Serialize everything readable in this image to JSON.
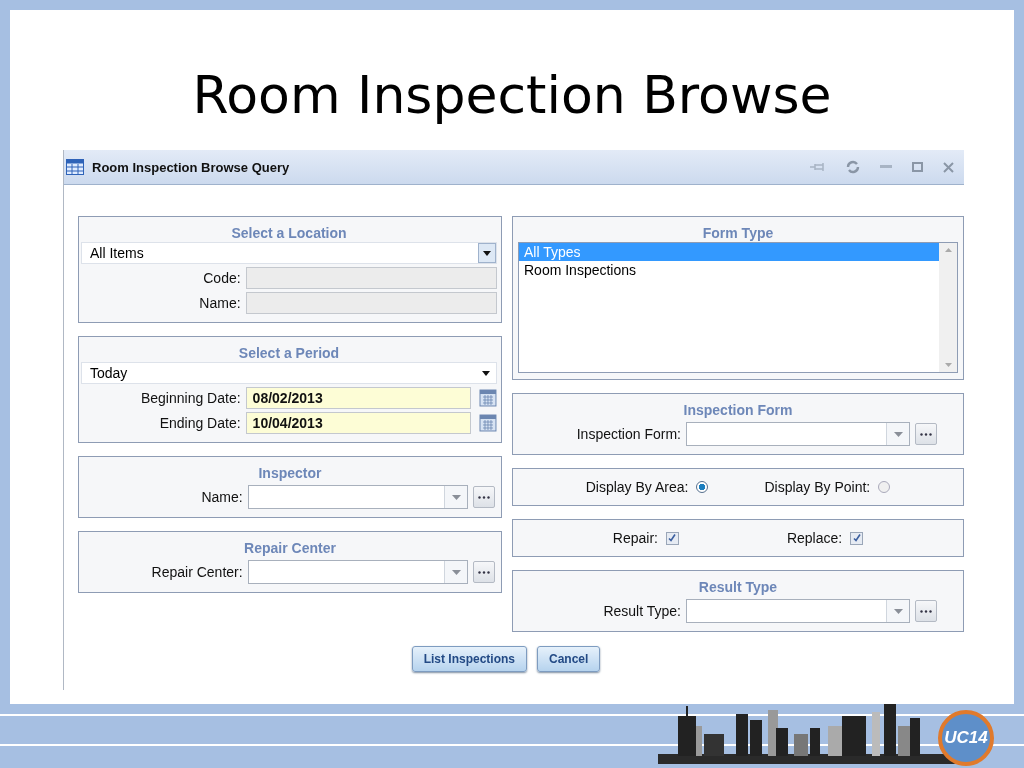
{
  "slide_title": "Room Inspection Browse",
  "window": {
    "title": "Room Inspection Browse Query"
  },
  "left_sections": [
    {
      "kind": "location",
      "heading": "Select a Location",
      "value": "All Items",
      "fields": [
        {
          "label": "Code:",
          "disabled": true
        },
        {
          "label": "Name:",
          "disabled": true
        }
      ]
    },
    {
      "kind": "period",
      "heading": "Select a Period",
      "value": "Today",
      "dates": [
        {
          "label": "Beginning Date:",
          "value": "08/02/2013"
        },
        {
          "label": "Ending Date:",
          "value": "10/04/2013"
        }
      ]
    },
    {
      "kind": "lookup",
      "heading": "Inspector",
      "label": "Name:"
    },
    {
      "kind": "lookup",
      "heading": "Repair Center",
      "label": "Repair Center:"
    }
  ],
  "right_sections": [
    {
      "kind": "listbox",
      "heading": "Form Type",
      "items": [
        {
          "label": "All Types",
          "selected": true
        },
        {
          "label": "Room Inspections",
          "selected": false
        }
      ]
    },
    {
      "kind": "lookup",
      "heading": "Inspection Form",
      "label": "Inspection Form:"
    },
    {
      "kind": "radios",
      "options": [
        {
          "label": "Display By Area:",
          "selected": true
        },
        {
          "label": "Display By Point:",
          "selected": false
        }
      ]
    },
    {
      "kind": "checks",
      "options": [
        {
          "label": "Repair:",
          "checked": true
        },
        {
          "label": "Replace:",
          "checked": true
        }
      ]
    },
    {
      "kind": "lookup",
      "heading": "Result Type",
      "label": "Result Type:"
    }
  ],
  "buttons": [
    "List Inspections",
    "Cancel"
  ],
  "footer": {
    "logo": "UC14"
  }
}
